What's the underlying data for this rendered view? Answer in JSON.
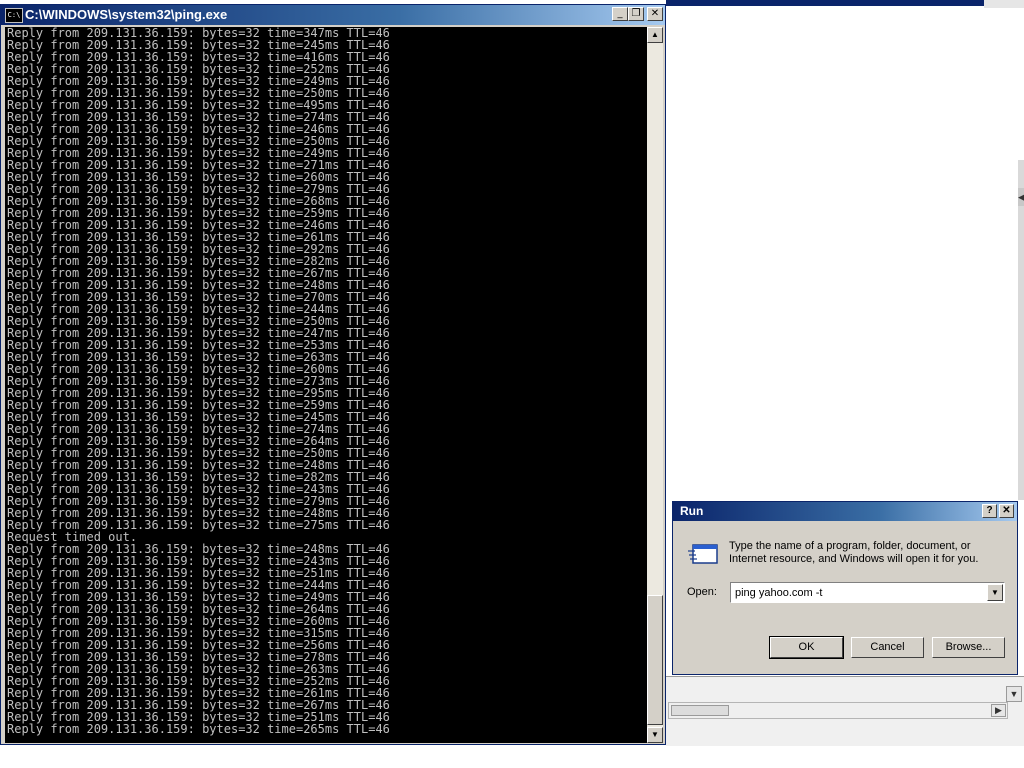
{
  "console": {
    "title": "C:\\WINDOWS\\system32\\ping.exe",
    "icon": "C:\\",
    "lines": [
      "Reply from 209.131.36.159: bytes=32 time=347ms TTL=46",
      "Reply from 209.131.36.159: bytes=32 time=245ms TTL=46",
      "Reply from 209.131.36.159: bytes=32 time=416ms TTL=46",
      "Reply from 209.131.36.159: bytes=32 time=252ms TTL=46",
      "Reply from 209.131.36.159: bytes=32 time=249ms TTL=46",
      "Reply from 209.131.36.159: bytes=32 time=250ms TTL=46",
      "Reply from 209.131.36.159: bytes=32 time=495ms TTL=46",
      "Reply from 209.131.36.159: bytes=32 time=274ms TTL=46",
      "Reply from 209.131.36.159: bytes=32 time=246ms TTL=46",
      "Reply from 209.131.36.159: bytes=32 time=250ms TTL=46",
      "Reply from 209.131.36.159: bytes=32 time=249ms TTL=46",
      "Reply from 209.131.36.159: bytes=32 time=271ms TTL=46",
      "Reply from 209.131.36.159: bytes=32 time=260ms TTL=46",
      "Reply from 209.131.36.159: bytes=32 time=279ms TTL=46",
      "Reply from 209.131.36.159: bytes=32 time=268ms TTL=46",
      "Reply from 209.131.36.159: bytes=32 time=259ms TTL=46",
      "Reply from 209.131.36.159: bytes=32 time=246ms TTL=46",
      "Reply from 209.131.36.159: bytes=32 time=261ms TTL=46",
      "Reply from 209.131.36.159: bytes=32 time=292ms TTL=46",
      "Reply from 209.131.36.159: bytes=32 time=282ms TTL=46",
      "Reply from 209.131.36.159: bytes=32 time=267ms TTL=46",
      "Reply from 209.131.36.159: bytes=32 time=248ms TTL=46",
      "Reply from 209.131.36.159: bytes=32 time=270ms TTL=46",
      "Reply from 209.131.36.159: bytes=32 time=244ms TTL=46",
      "Reply from 209.131.36.159: bytes=32 time=250ms TTL=46",
      "Reply from 209.131.36.159: bytes=32 time=247ms TTL=46",
      "Reply from 209.131.36.159: bytes=32 time=253ms TTL=46",
      "Reply from 209.131.36.159: bytes=32 time=263ms TTL=46",
      "Reply from 209.131.36.159: bytes=32 time=260ms TTL=46",
      "Reply from 209.131.36.159: bytes=32 time=273ms TTL=46",
      "Reply from 209.131.36.159: bytes=32 time=295ms TTL=46",
      "Reply from 209.131.36.159: bytes=32 time=259ms TTL=46",
      "Reply from 209.131.36.159: bytes=32 time=245ms TTL=46",
      "Reply from 209.131.36.159: bytes=32 time=274ms TTL=46",
      "Reply from 209.131.36.159: bytes=32 time=264ms TTL=46",
      "Reply from 209.131.36.159: bytes=32 time=250ms TTL=46",
      "Reply from 209.131.36.159: bytes=32 time=248ms TTL=46",
      "Reply from 209.131.36.159: bytes=32 time=282ms TTL=46",
      "Reply from 209.131.36.159: bytes=32 time=243ms TTL=46",
      "Reply from 209.131.36.159: bytes=32 time=279ms TTL=46",
      "Reply from 209.131.36.159: bytes=32 time=248ms TTL=46",
      "Reply from 209.131.36.159: bytes=32 time=275ms TTL=46",
      "Request timed out.",
      "Reply from 209.131.36.159: bytes=32 time=248ms TTL=46",
      "Reply from 209.131.36.159: bytes=32 time=243ms TTL=46",
      "Reply from 209.131.36.159: bytes=32 time=251ms TTL=46",
      "Reply from 209.131.36.159: bytes=32 time=244ms TTL=46",
      "Reply from 209.131.36.159: bytes=32 time=249ms TTL=46",
      "Reply from 209.131.36.159: bytes=32 time=264ms TTL=46",
      "Reply from 209.131.36.159: bytes=32 time=260ms TTL=46",
      "Reply from 209.131.36.159: bytes=32 time=315ms TTL=46",
      "Reply from 209.131.36.159: bytes=32 time=256ms TTL=46",
      "Reply from 209.131.36.159: bytes=32 time=278ms TTL=46",
      "Reply from 209.131.36.159: bytes=32 time=263ms TTL=46",
      "Reply from 209.131.36.159: bytes=32 time=252ms TTL=46",
      "Reply from 209.131.36.159: bytes=32 time=261ms TTL=46",
      "Reply from 209.131.36.159: bytes=32 time=267ms TTL=46",
      "Reply from 209.131.36.159: bytes=32 time=251ms TTL=46",
      "Reply from 209.131.36.159: bytes=32 time=265ms TTL=46"
    ],
    "caption_buttons": {
      "minimize": "_",
      "restore": "❐",
      "close": "✕"
    },
    "scroll_arrows": {
      "up": "▲",
      "down": "▼"
    }
  },
  "run_dialog": {
    "title": "Run",
    "help_button": "?",
    "close_button": "✕",
    "description": "Type the name of a program, folder, document, or Internet resource, and Windows will open it for you.",
    "open_label": "Open:",
    "open_value": "ping yahoo.com -t",
    "dropdown_arrow": "▼",
    "ok_label": "OK",
    "cancel_label": "Cancel",
    "browse_label": "Browse..."
  },
  "background_window": {
    "scroll_arrow_right": "▶",
    "scroll_arrow_down": "▼",
    "scroll_arrow_left": "◀"
  },
  "colors": {
    "console_bg": "#000000",
    "console_text": "#c0c0c0",
    "titlebar_active": "#0a246a",
    "dialog_face": "#d4d0c8"
  }
}
